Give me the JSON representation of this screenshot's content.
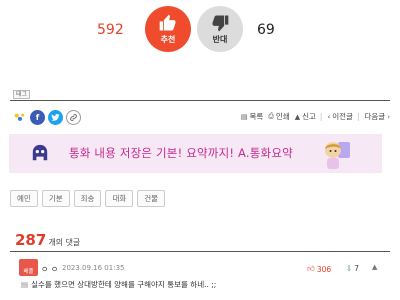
{
  "vote": {
    "up_count": "592",
    "up_label": "추천",
    "down_count": "69",
    "down_label": "반대"
  },
  "tag_label": "태그",
  "actions": {
    "list": "목록",
    "print": "인쇄",
    "report": "신고",
    "prev": "이전글",
    "next": "다음글"
  },
  "banner": {
    "text": "통화 내용 저장은 기본! 요약까지! A.통화요약"
  },
  "tags": [
    "예민",
    "기분",
    "죄송",
    "대화",
    "건물"
  ],
  "comments": {
    "count": "287",
    "label": "개의 댓글",
    "items": [
      {
        "badge": "배플",
        "name": "ㅇ ㅇ",
        "date": "2023.09.16 01:35",
        "likes": "306",
        "dislikes": "7",
        "body": "실수를 했으면 상대방한테 양해를 구해야지 통보를 하네.. ;;"
      }
    ]
  },
  "colors": {
    "accent": "#e8402b",
    "banner_bg": "#f7e8f5",
    "banner_text": "#c52c8f"
  },
  "icons": {
    "upvote": "thumbs-up-icon",
    "downvote": "thumbs-down-icon",
    "kakao": "kakao-icon",
    "facebook": "facebook-icon",
    "twitter": "twitter-icon",
    "link": "link-icon"
  }
}
